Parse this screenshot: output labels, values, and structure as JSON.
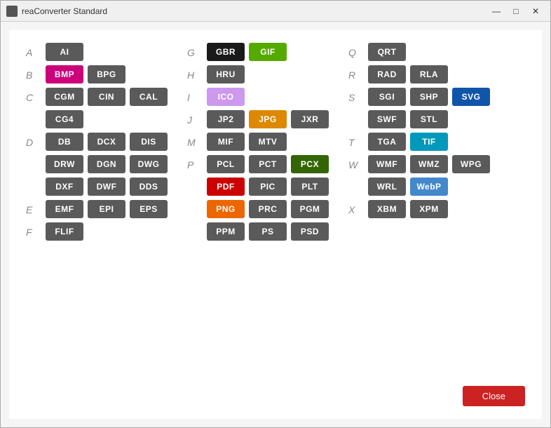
{
  "window": {
    "title": "reaConverter Standard",
    "controls": {
      "minimize": "—",
      "maximize": "□",
      "close": "✕"
    }
  },
  "close_button": "Close",
  "columns": [
    {
      "sections": [
        {
          "letter": "A",
          "formats": [
            {
              "label": "AI",
              "color": "#5a5a5a"
            }
          ]
        },
        {
          "letter": "B",
          "formats": [
            {
              "label": "BMP",
              "color": "#cc007a"
            },
            {
              "label": "BPG",
              "color": "#5a5a5a"
            }
          ]
        },
        {
          "letter": "C",
          "formats": [
            {
              "label": "CGM",
              "color": "#5a5a5a"
            },
            {
              "label": "CIN",
              "color": "#5a5a5a"
            },
            {
              "label": "CAL",
              "color": "#5a5a5a"
            },
            {
              "label": "CG4",
              "color": "#5a5a5a"
            }
          ]
        },
        {
          "letter": "D",
          "formats": [
            {
              "label": "DB",
              "color": "#5a5a5a"
            },
            {
              "label": "DCX",
              "color": "#5a5a5a"
            },
            {
              "label": "DIS",
              "color": "#5a5a5a"
            },
            {
              "label": "DRW",
              "color": "#5a5a5a"
            },
            {
              "label": "DGN",
              "color": "#5a5a5a"
            },
            {
              "label": "DWG",
              "color": "#5a5a5a"
            },
            {
              "label": "DXF",
              "color": "#5a5a5a"
            },
            {
              "label": "DWF",
              "color": "#5a5a5a"
            },
            {
              "label": "DDS",
              "color": "#5a5a5a"
            }
          ]
        },
        {
          "letter": "E",
          "formats": [
            {
              "label": "EMF",
              "color": "#5a5a5a"
            },
            {
              "label": "EPI",
              "color": "#5a5a5a"
            },
            {
              "label": "EPS",
              "color": "#5a5a5a"
            }
          ]
        },
        {
          "letter": "F",
          "formats": [
            {
              "label": "FLIF",
              "color": "#5a5a5a"
            }
          ]
        }
      ]
    },
    {
      "sections": [
        {
          "letter": "G",
          "formats": [
            {
              "label": "GBR",
              "color": "#1a1a1a"
            },
            {
              "label": "GIF",
              "color": "#55aa00"
            }
          ]
        },
        {
          "letter": "H",
          "formats": [
            {
              "label": "HRU",
              "color": "#5a5a5a"
            }
          ]
        },
        {
          "letter": "I",
          "formats": [
            {
              "label": "ICO",
              "color": "#cc99ee"
            }
          ]
        },
        {
          "letter": "J",
          "formats": [
            {
              "label": "JP2",
              "color": "#5a5a5a"
            },
            {
              "label": "JPG",
              "color": "#dd8800"
            },
            {
              "label": "JXR",
              "color": "#5a5a5a"
            }
          ]
        },
        {
          "letter": "M",
          "formats": [
            {
              "label": "MIF",
              "color": "#5a5a5a"
            },
            {
              "label": "MTV",
              "color": "#5a5a5a"
            }
          ]
        },
        {
          "letter": "P",
          "formats": [
            {
              "label": "PCL",
              "color": "#5a5a5a"
            },
            {
              "label": "PCT",
              "color": "#5a5a5a"
            },
            {
              "label": "PCX",
              "color": "#336600"
            },
            {
              "label": "PDF",
              "color": "#cc0000"
            },
            {
              "label": "PIC",
              "color": "#5a5a5a"
            },
            {
              "label": "PLT",
              "color": "#5a5a5a"
            },
            {
              "label": "PNG",
              "color": "#ee6600"
            },
            {
              "label": "PRC",
              "color": "#5a5a5a"
            },
            {
              "label": "PGM",
              "color": "#5a5a5a"
            },
            {
              "label": "PPM",
              "color": "#5a5a5a"
            },
            {
              "label": "PS",
              "color": "#5a5a5a"
            },
            {
              "label": "PSD",
              "color": "#5a5a5a"
            }
          ]
        }
      ]
    },
    {
      "sections": [
        {
          "letter": "Q",
          "formats": [
            {
              "label": "QRT",
              "color": "#5a5a5a"
            }
          ]
        },
        {
          "letter": "R",
          "formats": [
            {
              "label": "RAD",
              "color": "#5a5a5a"
            },
            {
              "label": "RLA",
              "color": "#5a5a5a"
            }
          ]
        },
        {
          "letter": "S",
          "formats": [
            {
              "label": "SGI",
              "color": "#5a5a5a"
            },
            {
              "label": "SHP",
              "color": "#5a5a5a"
            },
            {
              "label": "SVG",
              "color": "#1155aa"
            },
            {
              "label": "SWF",
              "color": "#5a5a5a"
            },
            {
              "label": "STL",
              "color": "#5a5a5a"
            }
          ]
        },
        {
          "letter": "T",
          "formats": [
            {
              "label": "TGA",
              "color": "#5a5a5a"
            },
            {
              "label": "TIF",
              "color": "#0099bb"
            }
          ]
        },
        {
          "letter": "W",
          "formats": [
            {
              "label": "WMF",
              "color": "#5a5a5a"
            },
            {
              "label": "WMZ",
              "color": "#5a5a5a"
            },
            {
              "label": "WPG",
              "color": "#5a5a5a"
            },
            {
              "label": "WRL",
              "color": "#5a5a5a"
            },
            {
              "label": "WebP",
              "color": "#4488cc"
            }
          ]
        },
        {
          "letter": "X",
          "formats": [
            {
              "label": "XBM",
              "color": "#5a5a5a"
            },
            {
              "label": "XPM",
              "color": "#5a5a5a"
            }
          ]
        }
      ]
    }
  ]
}
